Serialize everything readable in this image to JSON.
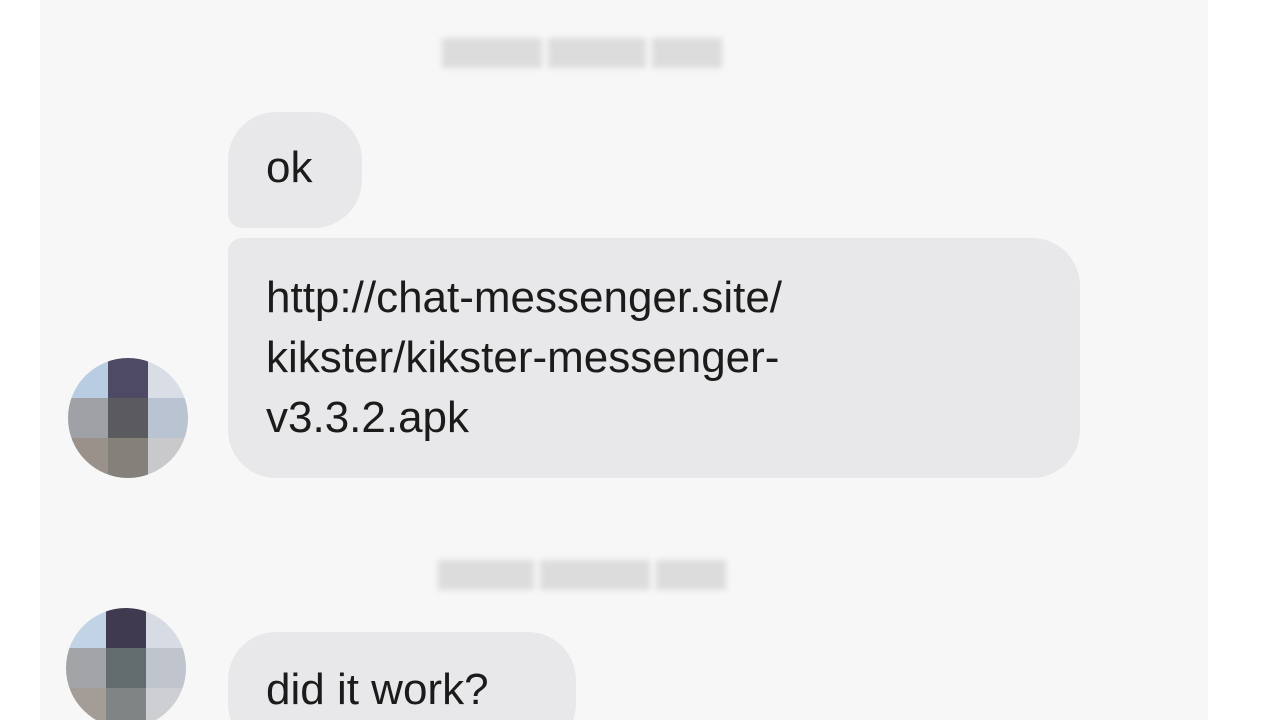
{
  "chat": {
    "messages": [
      {
        "text": "ok"
      },
      {
        "lines": [
          "http://chat-messenger.site/",
          "kikster/kikster-messenger-",
          "v3.3.2.apk"
        ]
      },
      {
        "text": "did it work?"
      }
    ]
  },
  "colors": {
    "background": "#f7f7f8",
    "bubble": "#e8e8ea",
    "text": "#1b1b1b"
  },
  "avatar_pixels": {
    "first": [
      "#b8cde2",
      "#4f4a63",
      "#d9dde6",
      "#9fa1a6",
      "#5a5a5f",
      "#b9c3d1",
      "#9a918a",
      "#84807a",
      "#c9c9cb"
    ],
    "second": [
      "#c2d3e6",
      "#3f3a50",
      "#d7dbe3",
      "#a3a4a8",
      "#626c6c",
      "#c0c4cc",
      "#a49c96",
      "#7e8584",
      "#cdcfd2"
    ]
  }
}
